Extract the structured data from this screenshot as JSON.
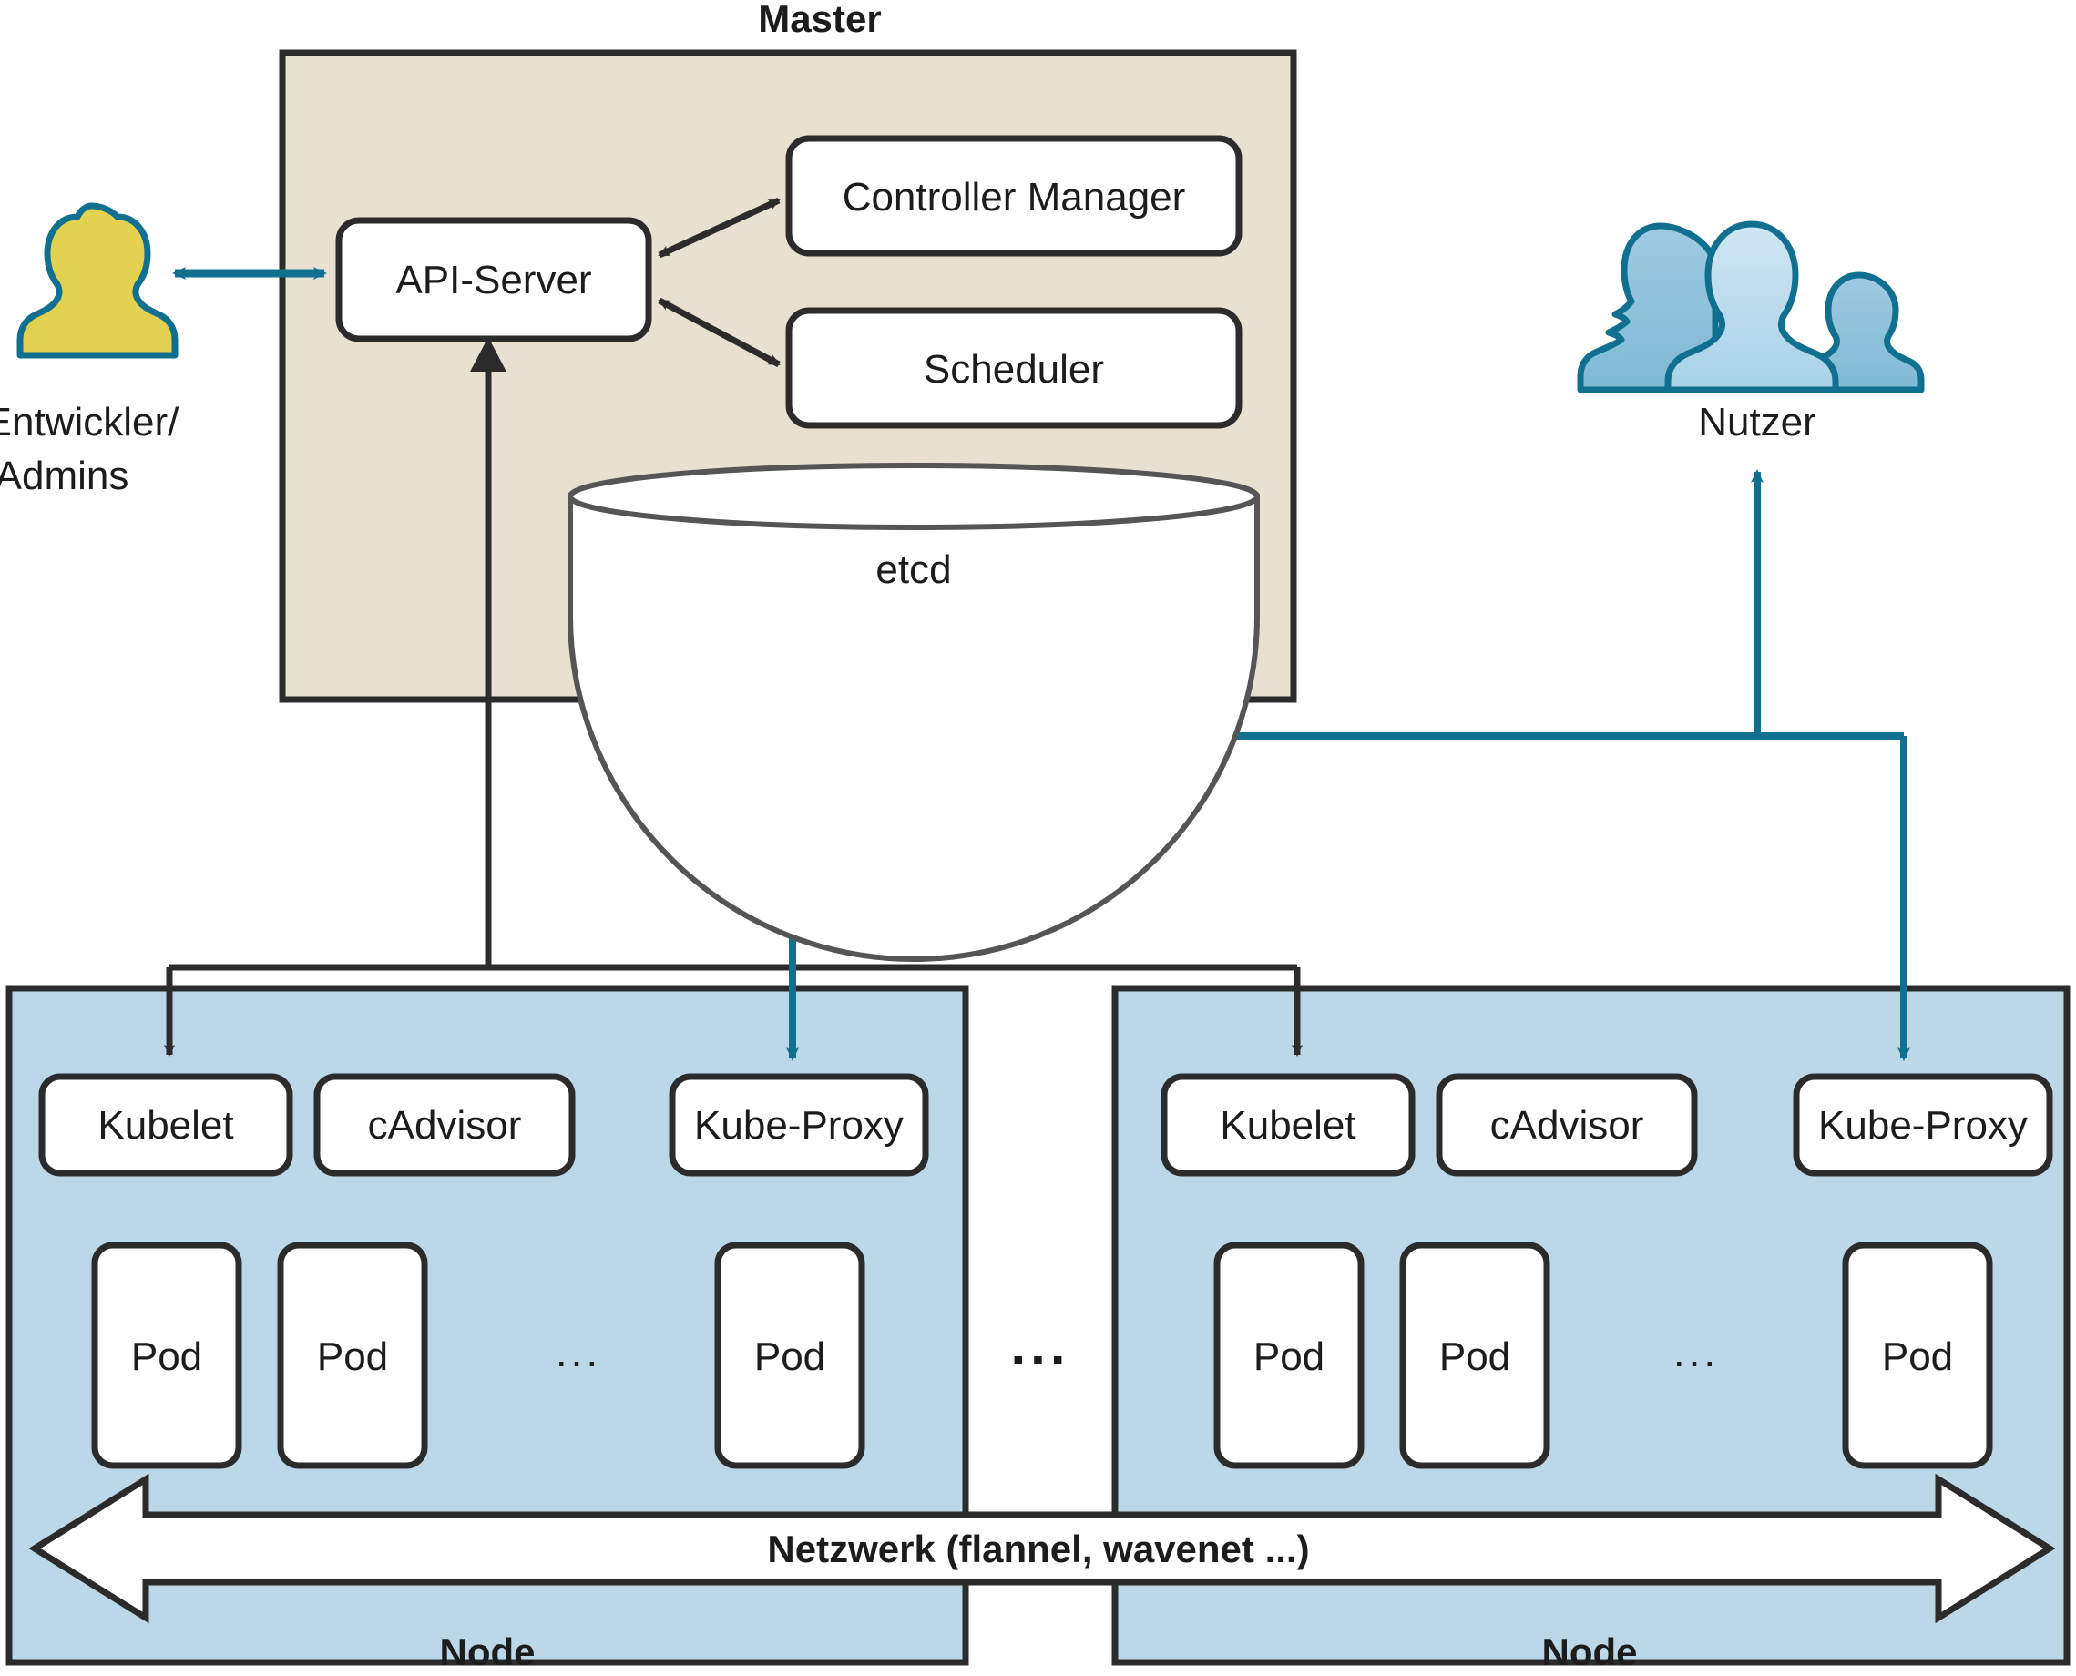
{
  "diagram": {
    "title_master": "Master",
    "colors": {
      "master_fill": "#e8e1d2",
      "node_fill": "#bcd8e8",
      "box_fill": "#ffffff",
      "box_stroke": "#2b2b2b",
      "teal_accent": "#11708f",
      "developer_fill": "#e3d24f",
      "developer_stroke": "#11708f",
      "user_fill_light": "#bcdcec",
      "user_fill_mid": "#8ec3dc",
      "user_stroke": "#11708f",
      "etcd_stroke": "#555555",
      "background": "#ffffff"
    },
    "actors": [
      {
        "id": "developer",
        "label_line1": "Entwickler/",
        "label_line2": "Admins",
        "icon": "single-person-icon"
      },
      {
        "id": "users",
        "label_line1": "Nutzer",
        "label_line2": "",
        "icon": "group-of-people-icon"
      }
    ],
    "master": {
      "label": "Master",
      "components": [
        {
          "id": "api-server",
          "label": "API-Server"
        },
        {
          "id": "controller-manager",
          "label": "Controller Manager"
        },
        {
          "id": "scheduler",
          "label": "Scheduler"
        },
        {
          "id": "etcd",
          "label": "etcd",
          "shape": "cylinder"
        }
      ]
    },
    "nodes": [
      {
        "id": "node-1",
        "label": "Node",
        "services": [
          {
            "id": "kubelet",
            "label": "Kubelet"
          },
          {
            "id": "cadvisor",
            "label": "cAdvisor"
          },
          {
            "id": "kube-proxy",
            "label": "Kube-Proxy"
          }
        ],
        "pods": [
          {
            "label": "Pod"
          },
          {
            "label": "Pod"
          },
          {
            "label": "Pod"
          }
        ],
        "pod_ellipsis": "...",
        "network_label": "Netzwerk (flannel, wavenet ...)"
      },
      {
        "id": "node-2",
        "label": "Node",
        "services": [
          {
            "id": "kubelet",
            "label": "Kubelet"
          },
          {
            "id": "cadvisor",
            "label": "cAdvisor"
          },
          {
            "id": "kube-proxy",
            "label": "Kube-Proxy"
          }
        ],
        "pods": [
          {
            "label": "Pod"
          },
          {
            "label": "Pod"
          },
          {
            "label": "Pod"
          }
        ],
        "pod_ellipsis": "...",
        "network_label": "Netzwerk (flannel, wavenet ...)"
      }
    ],
    "between_nodes_ellipsis": "...",
    "network": {
      "label": "Netzwerk (flannel, wavenet ...)"
    },
    "connections": [
      {
        "from": "developer",
        "to": "api-server",
        "style": "double-arrow",
        "color": "teal"
      },
      {
        "from": "api-server",
        "to": "controller-manager",
        "style": "double-arrow",
        "color": "black"
      },
      {
        "from": "api-server",
        "to": "scheduler",
        "style": "double-arrow",
        "color": "black"
      },
      {
        "from": "api-server",
        "to": "node-1.kubelet",
        "style": "arrow",
        "color": "black"
      },
      {
        "from": "api-server",
        "to": "node-2.kubelet",
        "style": "arrow",
        "color": "black"
      },
      {
        "from": "users",
        "to": "node-1.kube-proxy",
        "style": "arrow",
        "color": "teal"
      },
      {
        "from": "users",
        "to": "node-2.kube-proxy",
        "style": "arrow",
        "color": "teal"
      }
    ]
  }
}
